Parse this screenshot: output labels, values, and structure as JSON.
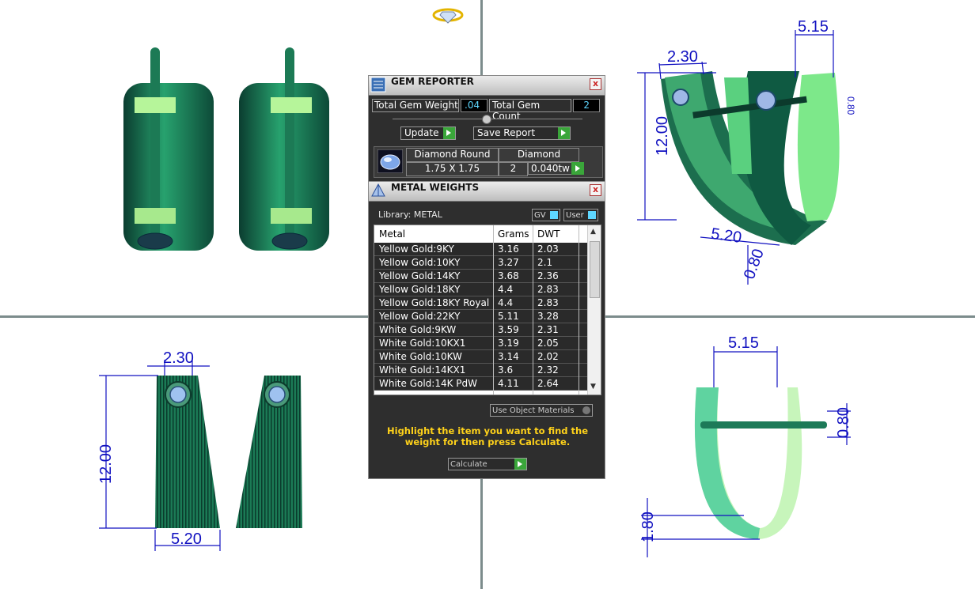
{
  "gem_reporter": {
    "title": "GEM REPORTER",
    "close_label": "x",
    "total_gem_weight_label": "Total Gem Weight",
    "total_gem_weight_value": ".04",
    "total_gem_count_label": "Total Gem Count",
    "total_gem_count_value": "2",
    "update_label": "Update",
    "save_report_label": "Save Report",
    "gem": {
      "shape": "Diamond Round",
      "type": "Diamond",
      "size": "1.75 X 1.75",
      "count": "2",
      "weight": "0.040tw"
    }
  },
  "metal_weights": {
    "title": "METAL WEIGHTS",
    "close_label": "x",
    "library_label": "Library: METAL",
    "gv_label": "GV",
    "user_label": "User",
    "columns": [
      "Metal",
      "Grams",
      "DWT"
    ],
    "rows": [
      {
        "metal": "Yellow Gold:9KY",
        "grams": "3.16",
        "dwt": "2.03"
      },
      {
        "metal": "Yellow Gold:10KY",
        "grams": "3.27",
        "dwt": "2.1"
      },
      {
        "metal": "Yellow Gold:14KY",
        "grams": "3.68",
        "dwt": "2.36"
      },
      {
        "metal": "Yellow Gold:18KY",
        "grams": "4.4",
        "dwt": "2.83"
      },
      {
        "metal": "Yellow Gold:18KY Royal",
        "grams": "4.4",
        "dwt": "2.83"
      },
      {
        "metal": "Yellow Gold:22KY",
        "grams": "5.11",
        "dwt": "3.28"
      },
      {
        "metal": "White Gold:9KW",
        "grams": "3.59",
        "dwt": "2.31"
      },
      {
        "metal": "White Gold:10KX1",
        "grams": "3.19",
        "dwt": "2.05"
      },
      {
        "metal": "White Gold:10KW",
        "grams": "3.14",
        "dwt": "2.02"
      },
      {
        "metal": "White Gold:14KX1",
        "grams": "3.6",
        "dwt": "2.32"
      },
      {
        "metal": "White Gold:14K PdW",
        "grams": "4.11",
        "dwt": "2.64"
      }
    ],
    "use_object_materials_label": "Use Object Materials",
    "instruction": "Highlight the item you want to find the weight for then press Calculate.",
    "calculate_label": "Calculate"
  },
  "dimensions": {
    "top_right_width": "5.15",
    "top_right_gem": "2.30",
    "top_right_height": "12.00",
    "top_right_base": "5.20",
    "top_right_thickness": "0.80",
    "top_right_side": "0.80",
    "bottom_left_gem": "2.30",
    "bottom_left_height": "12.00",
    "bottom_left_base": "5.20",
    "bottom_right_width": "5.15",
    "bottom_right_pin": "0.80",
    "bottom_right_bottom": "1.80"
  },
  "colors": {
    "metal_dark": "#0b4a3a",
    "metal_mid": "#1e8a62",
    "metal_light": "#6be28a",
    "dimension_blue": "#1010c0",
    "panel_bg": "#2e2e2e",
    "note_yellow": "#ffd21a",
    "gem_blue": "#7ea6e8"
  }
}
